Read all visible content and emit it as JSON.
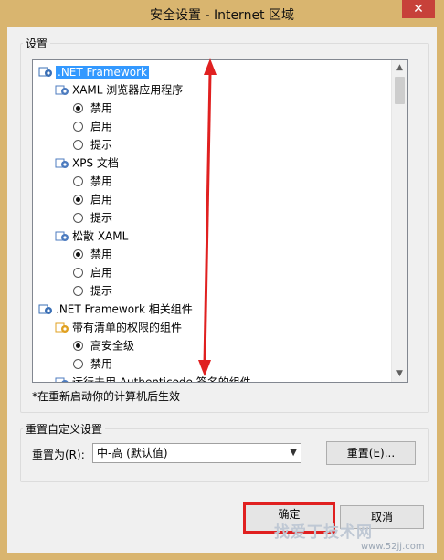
{
  "window": {
    "title": "安全设置 - Internet 区域",
    "close_glyph": "✕"
  },
  "settings_group": {
    "label": "设置"
  },
  "tree": {
    "items": [
      {
        "label": ".NET Framework",
        "type": "category",
        "icon": "shield-gear-icon",
        "selected": true
      },
      {
        "label": "XAML 浏览器应用程序",
        "type": "sub",
        "icon": "gear-icon"
      },
      {
        "label": "禁用",
        "type": "radio",
        "checked": true
      },
      {
        "label": "启用",
        "type": "radio",
        "checked": false
      },
      {
        "label": "提示",
        "type": "radio",
        "checked": false
      },
      {
        "label": "XPS 文档",
        "type": "sub",
        "icon": "gear-icon"
      },
      {
        "label": "禁用",
        "type": "radio",
        "checked": false
      },
      {
        "label": "启用",
        "type": "radio",
        "checked": true
      },
      {
        "label": "提示",
        "type": "radio",
        "checked": false
      },
      {
        "label": "松散 XAML",
        "type": "sub",
        "icon": "gear-icon"
      },
      {
        "label": "禁用",
        "type": "radio",
        "checked": true
      },
      {
        "label": "启用",
        "type": "radio",
        "checked": false
      },
      {
        "label": "提示",
        "type": "radio",
        "checked": false
      },
      {
        "label": ".NET Framework 相关组件",
        "type": "category",
        "icon": "shield-gear-icon"
      },
      {
        "label": "带有清单的权限的组件",
        "type": "sub",
        "icon": "shield-icon"
      },
      {
        "label": "高安全级",
        "type": "radio",
        "checked": true
      },
      {
        "label": "禁用",
        "type": "radio",
        "checked": false
      },
      {
        "label": "运行未用 Authenticode 签名的组件",
        "type": "sub",
        "icon": "gear-icon"
      }
    ]
  },
  "note": "*在重新启动你的计算机后生效",
  "reset_group": {
    "label": "重置自定义设置",
    "reset_to_label": "重置为(R):",
    "select_value": "中-高 (默认值)",
    "reset_button": "重置(E)..."
  },
  "footer": {
    "ok_button": "确定",
    "cancel_button": "取消"
  },
  "watermark": {
    "text": "找爱丁技术网",
    "url": "www.52jj.com"
  },
  "colors": {
    "title_bar": "#d9b56f",
    "selection": "#3399ff",
    "annotation": "#e02020"
  }
}
